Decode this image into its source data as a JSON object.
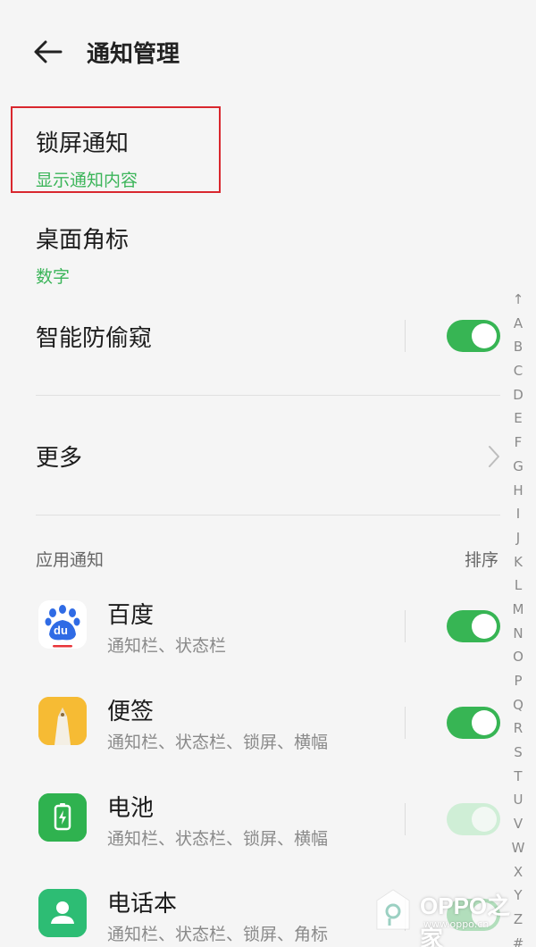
{
  "header": {
    "title": "通知管理",
    "back_icon": "arrow-left-icon"
  },
  "settings": {
    "lock_screen": {
      "label": "锁屏通知",
      "value": "显示通知内容"
    },
    "desktop_badge": {
      "label": "桌面角标",
      "value": "数字"
    },
    "smart_privacy": {
      "label": "智能防偷窥",
      "enabled": true
    },
    "more": {
      "label": "更多",
      "icon": "chevron-right-icon"
    }
  },
  "apps_section": {
    "title": "应用通知",
    "sort_label": "排序",
    "apps": [
      {
        "name": "百度",
        "desc": "通知栏、状态栏",
        "enabled": true,
        "icon": "baidu-app-icon",
        "icon_text": "du"
      },
      {
        "name": "便签",
        "desc": "通知栏、状态栏、锁屏、横幅",
        "enabled": true,
        "icon": "notes-app-icon"
      },
      {
        "name": "电池",
        "desc": "通知栏、状态栏、锁屏、横幅",
        "enabled": true,
        "disabled": true,
        "icon": "battery-app-icon"
      },
      {
        "name": "电话本",
        "desc": "通知栏、状态栏、锁屏、角标",
        "enabled": true,
        "icon": "contacts-app-icon"
      }
    ]
  },
  "index_bar": [
    "↑",
    "A",
    "B",
    "C",
    "D",
    "E",
    "F",
    "G",
    "H",
    "I",
    "J",
    "K",
    "L",
    "M",
    "N",
    "O",
    "P",
    "Q",
    "R",
    "S",
    "T",
    "U",
    "V",
    "W",
    "X",
    "Y",
    "Z",
    "#"
  ],
  "watermark": {
    "text": "OPPO之家",
    "url": "www.oppo.cn"
  },
  "colors": {
    "accent_green": "#37b554",
    "subtitle_green": "#3cb55a",
    "highlight_red": "#d9272e",
    "background": "#f5f5f5"
  }
}
